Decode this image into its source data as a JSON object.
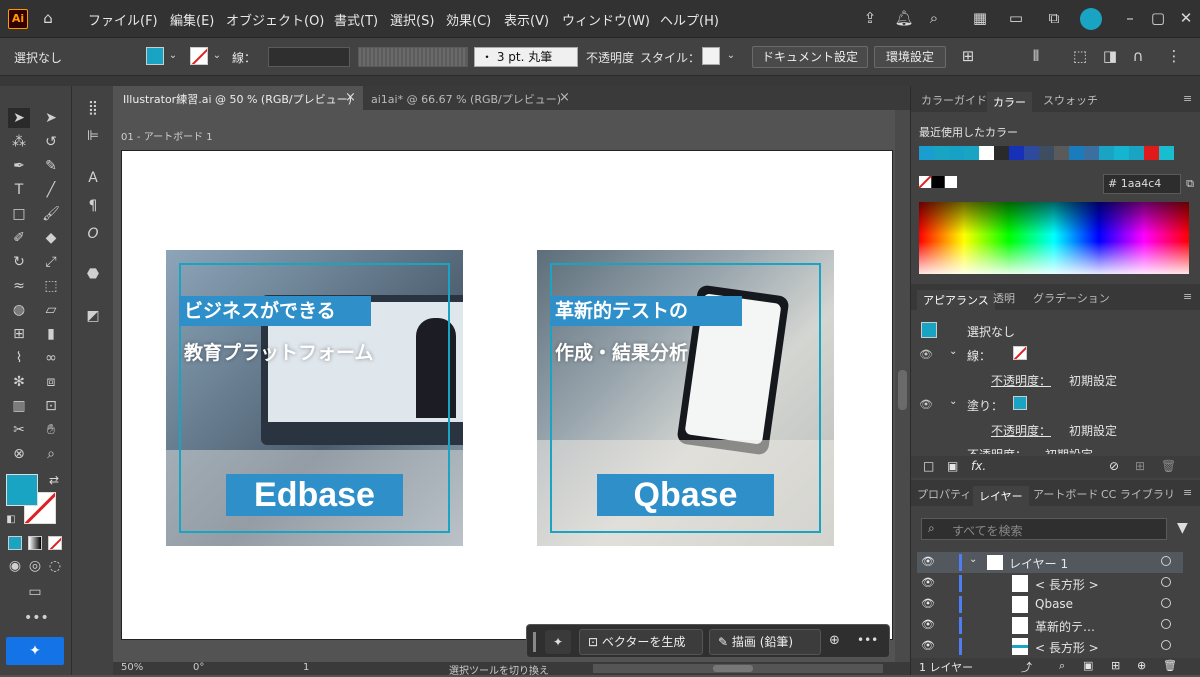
{
  "menubar": {
    "app_icon": "Ai",
    "items": [
      "ファイル(F)",
      "編集(E)",
      "オブジェクト(O)",
      "書式(T)",
      "選択(S)",
      "効果(C)",
      "表示(V)",
      "ウィンドウ(W)",
      "ヘルプ(H)"
    ]
  },
  "control": {
    "selection": "選択なし",
    "stroke_label": "線：",
    "brush": "・ 3 pt. 丸筆",
    "opacity_label": "不透明度",
    "style_label": "スタイル：",
    "doc_settings": "ドキュメント設定",
    "prefs": "環境設定"
  },
  "tabs": [
    {
      "label": "Illustrator練習.ai @ 50 % (RGB/プレビュー)",
      "close": "×"
    },
    {
      "label": "ai1ai* @ 66.67 % (RGB/プレビュー)",
      "close": "×"
    }
  ],
  "artboard": {
    "label": "01 - アートボード 1"
  },
  "cards": [
    {
      "line1": "ビジネスができる",
      "line2": "教育プラットフォーム",
      "name": "Edbase"
    },
    {
      "line1": "革新的テストの",
      "line2": "作成・結果分析",
      "name": "Qbase"
    }
  ],
  "float_bar": {
    "vector": "ベクターを生成",
    "draw": "描画 (鉛筆)",
    "more": "•••"
  },
  "status": {
    "zoom": "50%",
    "rotate": "0°",
    "page": "1",
    "hint": "選択ツールを切り換え"
  },
  "color_panel": {
    "tabs": [
      "カラーガイド",
      "カラー",
      "スウォッチ"
    ],
    "recent_label": "最近使用したカラー",
    "hex": "1aa4c4",
    "recent_colors": [
      "#1a9ed1",
      "#1aa4c4",
      "#16a2c6",
      "#1aa4c4",
      "#ffffff",
      "#2a2a2a",
      "#1730b8",
      "#2e4a9e",
      "#3c4e60",
      "#5a5a5a",
      "#1a7cbd",
      "#3a6fa0",
      "#1aa4c4",
      "#15b4d0",
      "#1aa4c4",
      "#e01a1a",
      "#1abcd0"
    ]
  },
  "appearance": {
    "tabs": [
      "アピアランス",
      "透明",
      "グラデーション"
    ],
    "selection": "選択なし",
    "stroke": "線：",
    "opacity_label": "不透明度：",
    "opacity_value": "初期設定",
    "fill": "塗り：",
    "fx": "fx."
  },
  "layers": {
    "tabs": [
      "プロパティ",
      "レイヤー",
      "アートボード",
      "CC ライブラリ"
    ],
    "search_placeholder": "すべてを検索",
    "rows": [
      "レイヤー 1",
      "< 長方形 >",
      "Qbase",
      "革新的テ…",
      "< 長方形 >"
    ],
    "count": "1 レイヤー"
  },
  "colors": {
    "accent": "#1aa4c4",
    "bg": "#535353",
    "panel": "#424242"
  }
}
